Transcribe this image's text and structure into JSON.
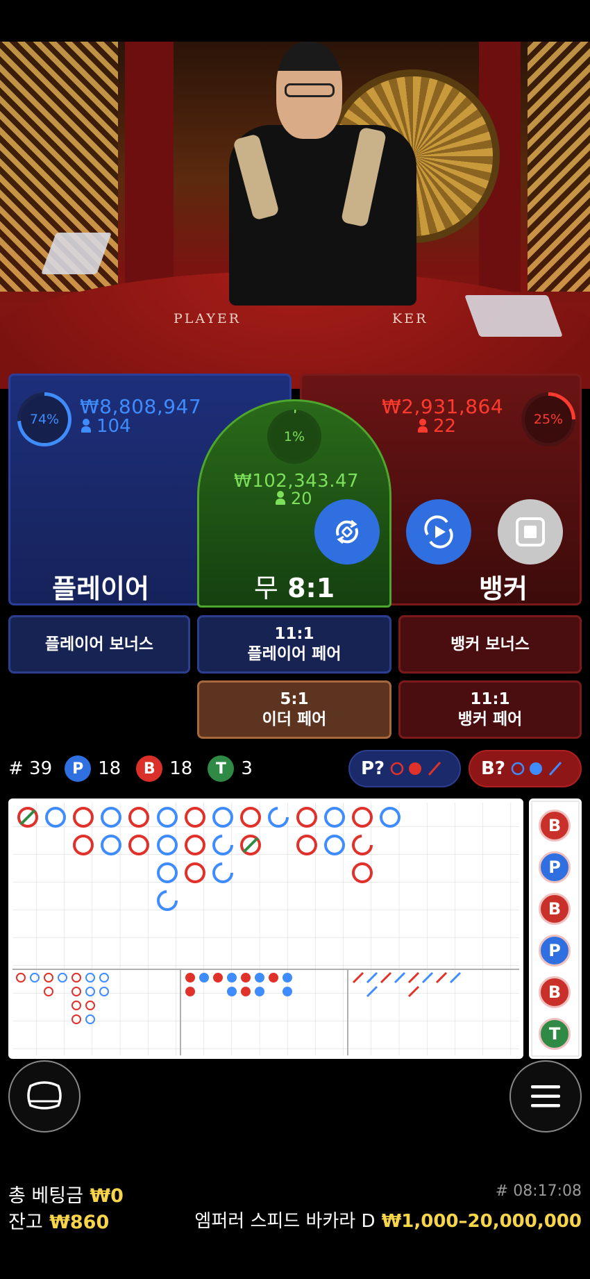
{
  "video": {
    "table_player": "PLAYER",
    "table_banker": "KER"
  },
  "player": {
    "percent": "74%",
    "percent_value": 74,
    "amount": "₩8,808,947",
    "bettors": "104",
    "label": "플레이어",
    "color": "#3f8cff"
  },
  "tie": {
    "percent": "1%",
    "percent_value": 1,
    "amount": "₩102,343.47",
    "bettors": "20",
    "label_text": "무",
    "label_odds": "8:1",
    "color": "#7de05a"
  },
  "banker": {
    "percent": "25%",
    "percent_value": 25,
    "amount": "₩2,931,864",
    "bettors": "22",
    "label": "뱅커",
    "color": "#ff3b30"
  },
  "controls": {
    "repeat_icon": "refresh-icon",
    "replay_icon": "play-circle-icon",
    "stop_icon": "stop-icon"
  },
  "side_bets": {
    "player_bonus": "플레이어 보너스",
    "player_pair": {
      "odds": "11:1",
      "label": "플레이어 페어"
    },
    "banker_bonus": "뱅커 보너스",
    "either_pair": {
      "odds": "5:1",
      "label": "이더 페어"
    },
    "banker_pair": {
      "odds": "11:1",
      "label": "뱅커 페어"
    }
  },
  "stats": {
    "round": "# 39",
    "p_label": "P",
    "p_count": "18",
    "b_label": "B",
    "b_count": "18",
    "t_label": "T",
    "t_count": "3"
  },
  "predict": {
    "player": "P?",
    "banker": "B?"
  },
  "side_road": [
    "B",
    "P",
    "B",
    "P",
    "B",
    "T"
  ],
  "footer": {
    "total_bet_label": "총 베팅금",
    "total_bet_value": "₩0",
    "balance_label": "잔고",
    "balance_value": "₩860",
    "round_time": "# 08:17:08",
    "table_name": "엠퍼러 스피드 바카라 D",
    "limits": "₩1,000–20,000,000"
  }
}
